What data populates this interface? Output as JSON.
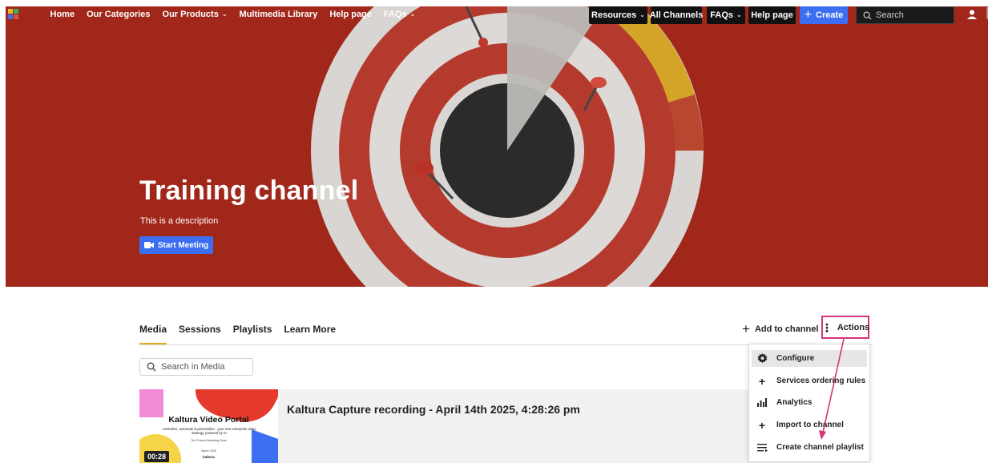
{
  "nav": {
    "left_items": [
      {
        "label": "Home",
        "dropdown": false
      },
      {
        "label": "Our Categories",
        "dropdown": false
      },
      {
        "label": "Our Products",
        "dropdown": true
      },
      {
        "label": "Multimedia Library",
        "dropdown": false
      },
      {
        "label": "Help page",
        "dropdown": false
      },
      {
        "label": "FAQs",
        "dropdown": true
      }
    ],
    "resources_label": "Resources",
    "all_channels_label": "All Channels",
    "faqs_label": "FAQs",
    "help_label": "Help page",
    "create_label": "Create",
    "search_placeholder": "Search"
  },
  "hero": {
    "title": "Training channel",
    "description": "This is a description",
    "meeting_button": "Start Meeting"
  },
  "tabs": [
    {
      "label": "Media",
      "active": true
    },
    {
      "label": "Sessions",
      "active": false
    },
    {
      "label": "Playlists",
      "active": false
    },
    {
      "label": "Learn More",
      "active": false
    }
  ],
  "toolbar": {
    "add_to_channel": "Add to channel",
    "actions": "Actions"
  },
  "media_search_placeholder": "Search in Media",
  "media": [
    {
      "title": "Kaltura Capture recording - April 14th 2025, 4:28:26 pm",
      "duration": "00:28",
      "thumb_title": "Kaltura Video Portal",
      "thumb_subtitle": "Centralize, automate & personalize - your new enterprise video strategy, powered by AI",
      "thumb_team": "The Product Marketing Team",
      "thumb_date": "March 2025",
      "thumb_logo": "kaltura"
    }
  ],
  "actions_menu": [
    {
      "label": "Configure",
      "icon": "gear-icon",
      "highlighted": true
    },
    {
      "label": "Services ordering rules",
      "icon": "plus-icon",
      "highlighted": false
    },
    {
      "label": "Analytics",
      "icon": "analytics-icon",
      "highlighted": false
    },
    {
      "label": "Import to channel",
      "icon": "plus-icon",
      "highlighted": false
    },
    {
      "label": "Create channel playlist",
      "icon": "playlist-icon",
      "highlighted": false
    }
  ],
  "colors": {
    "hero_red": "#a0271a",
    "accent_blue": "#3b6ef0",
    "annotation_pink": "#d6337a",
    "tab_underline": "#e3a82a"
  }
}
